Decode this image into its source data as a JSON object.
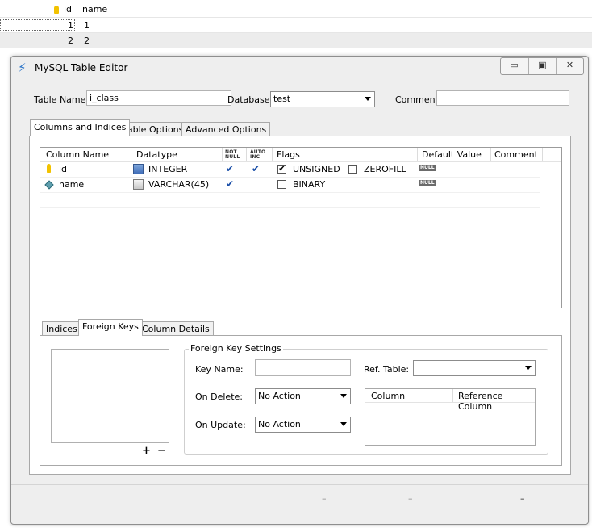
{
  "background_grid": {
    "columns": [
      "id",
      "name"
    ],
    "rows": [
      {
        "id": "1",
        "name": "1"
      },
      {
        "id": "2",
        "name": "2"
      }
    ]
  },
  "window": {
    "title": "MySQL Table Editor",
    "minimize": "▭",
    "maximize": "▣",
    "close": "✕"
  },
  "form": {
    "table_name_label": "Table Name:",
    "table_name_value": "i_class",
    "database_label": "Database:",
    "database_value": "test",
    "comment_label": "Comment:",
    "comment_value": ""
  },
  "main_tabs": [
    "Columns and Indices",
    "Table Options",
    "Advanced Options"
  ],
  "columns_grid": {
    "headers": {
      "column_name": "Column Name",
      "datatype": "Datatype",
      "not_null_1": "NOT",
      "not_null_2": "NULL",
      "auto_inc_1": "AUTO",
      "auto_inc_2": "INC",
      "flags": "Flags",
      "default_value": "Default Value",
      "comment": "Comment"
    },
    "rows": [
      {
        "name": "id",
        "datatype": "INTEGER",
        "not_null": "✔",
        "auto_inc": "✔",
        "flag1_label": "UNSIGNED",
        "flag1_checked": "✔",
        "flag2_label": "ZEROFILL",
        "default": "NULL"
      },
      {
        "name": "name",
        "datatype": "VARCHAR(45)",
        "not_null": "✔",
        "flag1_label": "BINARY",
        "default": "NULL"
      }
    ]
  },
  "sub_tabs": [
    "Indices",
    "Foreign Keys",
    "Column Details"
  ],
  "foreign_keys": {
    "add_label": "+",
    "remove_label": "−",
    "settings_title": "Foreign Key Settings",
    "key_name_label": "Key Name:",
    "key_name_value": "",
    "ref_table_label": "Ref. Table:",
    "ref_table_value": "",
    "on_delete_label": "On Delete:",
    "on_delete_value": "No Action",
    "on_update_label": "On Update:",
    "on_update_value": "No Action",
    "mapping_headers": [
      "Column",
      "Reference Column"
    ]
  },
  "footer": {
    "btn1": "–",
    "btn2": "–",
    "btn3": "–"
  },
  "colors": {
    "accent": "#2a74c8",
    "check": "#1a4fa8",
    "window_bg": "#eeeeee"
  }
}
